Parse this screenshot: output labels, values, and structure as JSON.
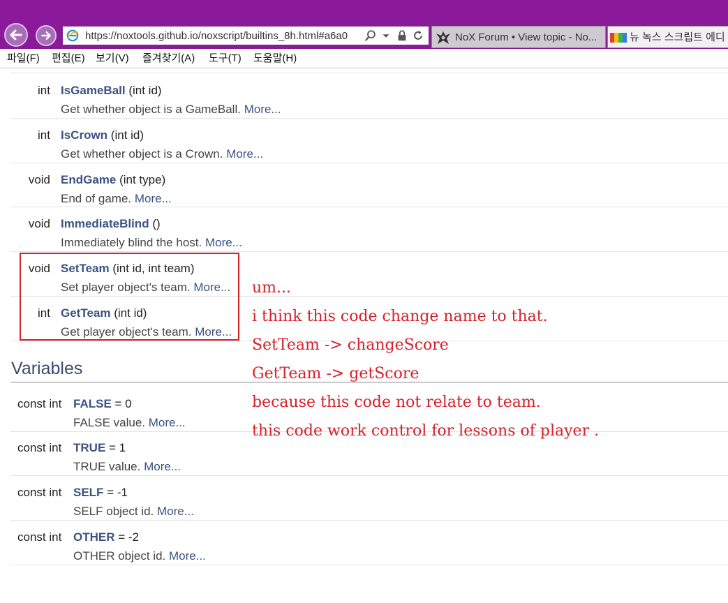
{
  "browser": {
    "url": "https://noxtools.github.io/noxscript/builtins_8h.html#a6a0",
    "tabs": [
      {
        "label": "NoX Forum • View topic - No..."
      },
      {
        "label": "뉴 녹스 스크립트 에디"
      }
    ],
    "menu": [
      "파일(F)",
      "편집(E)",
      "보기(V)",
      "즐겨찾기(A)",
      "도구(T)",
      "도움말(H)"
    ]
  },
  "functions": [
    {
      "type": "int",
      "name": "IsGameBall",
      "args": "(int id)",
      "desc": "Get whether object is a GameBall.",
      "more": "More..."
    },
    {
      "type": "int",
      "name": "IsCrown",
      "args": "(int id)",
      "desc": "Get whether object is a Crown.",
      "more": "More..."
    },
    {
      "type": "void",
      "name": "EndGame",
      "args": "(int type)",
      "desc": "End of game.",
      "more": "More..."
    },
    {
      "type": "void",
      "name": "ImmediateBlind",
      "args": "()",
      "desc": "Immediately blind the host.",
      "more": "More..."
    },
    {
      "type": "void",
      "name": "SetTeam",
      "args": "(int id, int team)",
      "desc": "Set player object's team.",
      "more": "More..."
    },
    {
      "type": "int",
      "name": "GetTeam",
      "args": "(int id)",
      "desc": "Get player object's team.",
      "more": "More..."
    }
  ],
  "variables_heading": "Variables",
  "variables": [
    {
      "type": "const int",
      "name": "FALSE",
      "value": "= 0",
      "desc": "FALSE value.",
      "more": "More..."
    },
    {
      "type": "const int",
      "name": "TRUE",
      "value": "= 1",
      "desc": "TRUE value.",
      "more": "More..."
    },
    {
      "type": "const int",
      "name": "SELF",
      "value": "= -1",
      "desc": "SELF object id.",
      "more": "More..."
    },
    {
      "type": "const int",
      "name": "OTHER",
      "value": "= -2",
      "desc": "OTHER object id.",
      "more": "More..."
    }
  ],
  "annotation": {
    "color": "#d6202a",
    "lines": [
      "um...",
      "i think this code change name to that.",
      "SetTeam -> changeScore",
      "GetTeam -> getScore",
      "because this code not relate to team.",
      "this code work control for lessons of player ."
    ]
  },
  "colors": {
    "chrome": "#8b1a9a",
    "link": "#3b5283"
  }
}
